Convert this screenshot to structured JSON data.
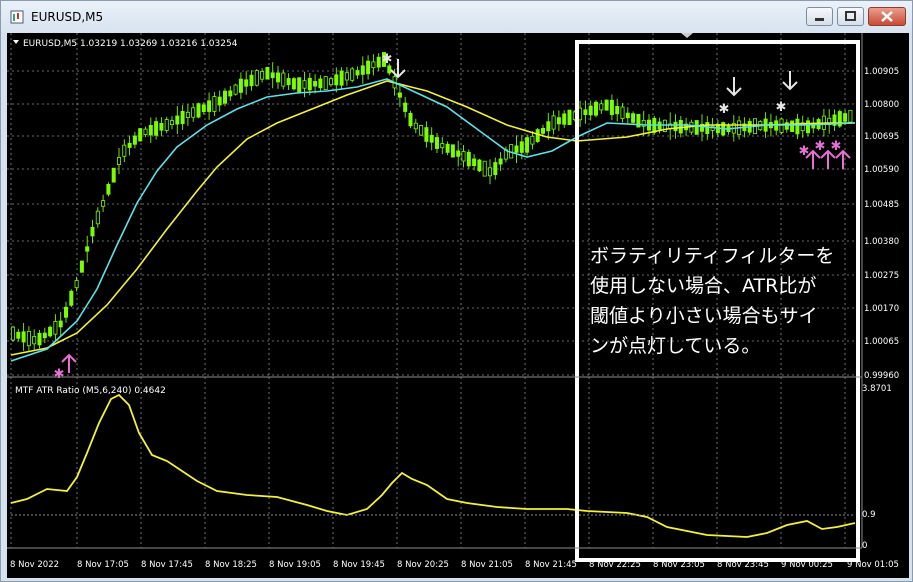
{
  "window": {
    "title": "EURUSD,M5"
  },
  "main_chart": {
    "header": "EURUSD,M5  1.03219 1.03269 1.03216 1.03254",
    "price_labels": [
      "1.00905",
      "1.00800",
      "1.00695",
      "1.00590",
      "1.00485",
      "1.00380",
      "1.00275",
      "1.00170",
      "1.00065",
      "0.99960"
    ]
  },
  "sub_chart": {
    "header": "MTF ATR Ratio  (M5,6,240) 0.4642",
    "top_value": "3.8701",
    "level_value": "0.9",
    "bottom_value": "0"
  },
  "time_axis": [
    "8 Nov 2022",
    "8 Nov 17:05",
    "8 Nov 17:45",
    "8 Nov 18:25",
    "8 Nov 19:05",
    "8 Nov 19:45",
    "8 Nov 20:25",
    "8 Nov 21:05",
    "8 Nov 21:45",
    "8 Nov 22:25",
    "8 Nov 23:05",
    "8 Nov 23:45",
    "9 Nov 00:25",
    "9 Nov 01:05"
  ],
  "annotation": {
    "text": "ボラティリティフィルターを\n使用しない場合、ATR比が\n閾値より小さい場合もサイ\nンが点灯している。"
  },
  "colors": {
    "background": "#000000",
    "grid": "#8c8c8c",
    "candle": "#7CFC00",
    "ma_fast": "#5ee0e6",
    "ma_slow": "#f2f23a",
    "atr_line": "#f2f23a",
    "signal_sell": "#e6e6e6",
    "signal_buy": "#e86fd6",
    "highlight_box": "#ffffff"
  }
}
